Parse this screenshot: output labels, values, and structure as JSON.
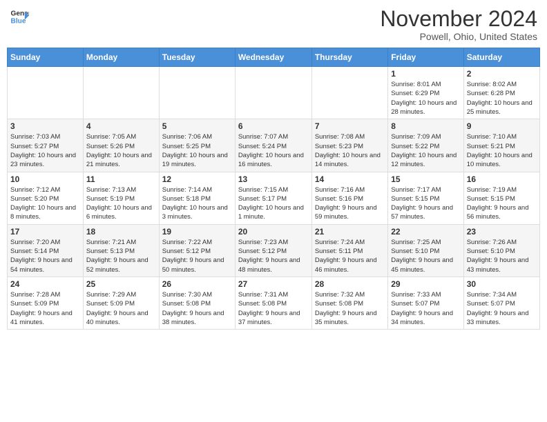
{
  "header": {
    "logo_line1": "General",
    "logo_line2": "Blue",
    "month_year": "November 2024",
    "location": "Powell, Ohio, United States"
  },
  "weekdays": [
    "Sunday",
    "Monday",
    "Tuesday",
    "Wednesday",
    "Thursday",
    "Friday",
    "Saturday"
  ],
  "weeks": [
    [
      {
        "day": "",
        "sunrise": "",
        "sunset": "",
        "daylight": ""
      },
      {
        "day": "",
        "sunrise": "",
        "sunset": "",
        "daylight": ""
      },
      {
        "day": "",
        "sunrise": "",
        "sunset": "",
        "daylight": ""
      },
      {
        "day": "",
        "sunrise": "",
        "sunset": "",
        "daylight": ""
      },
      {
        "day": "",
        "sunrise": "",
        "sunset": "",
        "daylight": ""
      },
      {
        "day": "1",
        "sunrise": "Sunrise: 8:01 AM",
        "sunset": "Sunset: 6:29 PM",
        "daylight": "Daylight: 10 hours and 28 minutes."
      },
      {
        "day": "2",
        "sunrise": "Sunrise: 8:02 AM",
        "sunset": "Sunset: 6:28 PM",
        "daylight": "Daylight: 10 hours and 25 minutes."
      }
    ],
    [
      {
        "day": "3",
        "sunrise": "Sunrise: 7:03 AM",
        "sunset": "Sunset: 5:27 PM",
        "daylight": "Daylight: 10 hours and 23 minutes."
      },
      {
        "day": "4",
        "sunrise": "Sunrise: 7:05 AM",
        "sunset": "Sunset: 5:26 PM",
        "daylight": "Daylight: 10 hours and 21 minutes."
      },
      {
        "day": "5",
        "sunrise": "Sunrise: 7:06 AM",
        "sunset": "Sunset: 5:25 PM",
        "daylight": "Daylight: 10 hours and 19 minutes."
      },
      {
        "day": "6",
        "sunrise": "Sunrise: 7:07 AM",
        "sunset": "Sunset: 5:24 PM",
        "daylight": "Daylight: 10 hours and 16 minutes."
      },
      {
        "day": "7",
        "sunrise": "Sunrise: 7:08 AM",
        "sunset": "Sunset: 5:23 PM",
        "daylight": "Daylight: 10 hours and 14 minutes."
      },
      {
        "day": "8",
        "sunrise": "Sunrise: 7:09 AM",
        "sunset": "Sunset: 5:22 PM",
        "daylight": "Daylight: 10 hours and 12 minutes."
      },
      {
        "day": "9",
        "sunrise": "Sunrise: 7:10 AM",
        "sunset": "Sunset: 5:21 PM",
        "daylight": "Daylight: 10 hours and 10 minutes."
      }
    ],
    [
      {
        "day": "10",
        "sunrise": "Sunrise: 7:12 AM",
        "sunset": "Sunset: 5:20 PM",
        "daylight": "Daylight: 10 hours and 8 minutes."
      },
      {
        "day": "11",
        "sunrise": "Sunrise: 7:13 AM",
        "sunset": "Sunset: 5:19 PM",
        "daylight": "Daylight: 10 hours and 6 minutes."
      },
      {
        "day": "12",
        "sunrise": "Sunrise: 7:14 AM",
        "sunset": "Sunset: 5:18 PM",
        "daylight": "Daylight: 10 hours and 3 minutes."
      },
      {
        "day": "13",
        "sunrise": "Sunrise: 7:15 AM",
        "sunset": "Sunset: 5:17 PM",
        "daylight": "Daylight: 10 hours and 1 minute."
      },
      {
        "day": "14",
        "sunrise": "Sunrise: 7:16 AM",
        "sunset": "Sunset: 5:16 PM",
        "daylight": "Daylight: 9 hours and 59 minutes."
      },
      {
        "day": "15",
        "sunrise": "Sunrise: 7:17 AM",
        "sunset": "Sunset: 5:15 PM",
        "daylight": "Daylight: 9 hours and 57 minutes."
      },
      {
        "day": "16",
        "sunrise": "Sunrise: 7:19 AM",
        "sunset": "Sunset: 5:15 PM",
        "daylight": "Daylight: 9 hours and 56 minutes."
      }
    ],
    [
      {
        "day": "17",
        "sunrise": "Sunrise: 7:20 AM",
        "sunset": "Sunset: 5:14 PM",
        "daylight": "Daylight: 9 hours and 54 minutes."
      },
      {
        "day": "18",
        "sunrise": "Sunrise: 7:21 AM",
        "sunset": "Sunset: 5:13 PM",
        "daylight": "Daylight: 9 hours and 52 minutes."
      },
      {
        "day": "19",
        "sunrise": "Sunrise: 7:22 AM",
        "sunset": "Sunset: 5:12 PM",
        "daylight": "Daylight: 9 hours and 50 minutes."
      },
      {
        "day": "20",
        "sunrise": "Sunrise: 7:23 AM",
        "sunset": "Sunset: 5:12 PM",
        "daylight": "Daylight: 9 hours and 48 minutes."
      },
      {
        "day": "21",
        "sunrise": "Sunrise: 7:24 AM",
        "sunset": "Sunset: 5:11 PM",
        "daylight": "Daylight: 9 hours and 46 minutes."
      },
      {
        "day": "22",
        "sunrise": "Sunrise: 7:25 AM",
        "sunset": "Sunset: 5:10 PM",
        "daylight": "Daylight: 9 hours and 45 minutes."
      },
      {
        "day": "23",
        "sunrise": "Sunrise: 7:26 AM",
        "sunset": "Sunset: 5:10 PM",
        "daylight": "Daylight: 9 hours and 43 minutes."
      }
    ],
    [
      {
        "day": "24",
        "sunrise": "Sunrise: 7:28 AM",
        "sunset": "Sunset: 5:09 PM",
        "daylight": "Daylight: 9 hours and 41 minutes."
      },
      {
        "day": "25",
        "sunrise": "Sunrise: 7:29 AM",
        "sunset": "Sunset: 5:09 PM",
        "daylight": "Daylight: 9 hours and 40 minutes."
      },
      {
        "day": "26",
        "sunrise": "Sunrise: 7:30 AM",
        "sunset": "Sunset: 5:08 PM",
        "daylight": "Daylight: 9 hours and 38 minutes."
      },
      {
        "day": "27",
        "sunrise": "Sunrise: 7:31 AM",
        "sunset": "Sunset: 5:08 PM",
        "daylight": "Daylight: 9 hours and 37 minutes."
      },
      {
        "day": "28",
        "sunrise": "Sunrise: 7:32 AM",
        "sunset": "Sunset: 5:08 PM",
        "daylight": "Daylight: 9 hours and 35 minutes."
      },
      {
        "day": "29",
        "sunrise": "Sunrise: 7:33 AM",
        "sunset": "Sunset: 5:07 PM",
        "daylight": "Daylight: 9 hours and 34 minutes."
      },
      {
        "day": "30",
        "sunrise": "Sunrise: 7:34 AM",
        "sunset": "Sunset: 5:07 PM",
        "daylight": "Daylight: 9 hours and 33 minutes."
      }
    ]
  ]
}
